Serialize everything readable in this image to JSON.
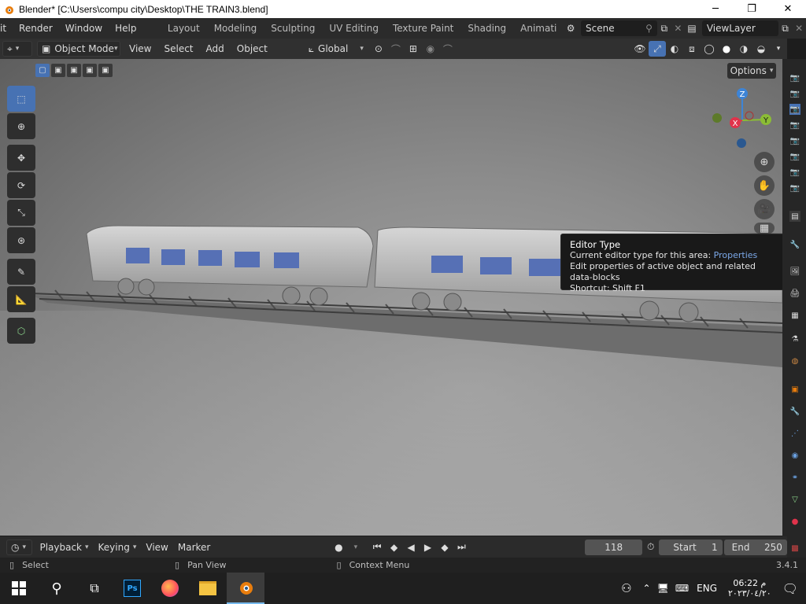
{
  "window": {
    "title": "Blender* [C:\\Users\\compu city\\Desktop\\THE TRAIN3.blend]",
    "minimize": "─",
    "maximize": "❐",
    "close": "✕"
  },
  "topbar": {
    "menus": [
      "it",
      "Render",
      "Window",
      "Help"
    ],
    "workspaces": [
      "Layout",
      "Modeling",
      "Sculpting",
      "UV Editing",
      "Texture Paint",
      "Shading",
      "Animati"
    ],
    "scene": "Scene",
    "view_layer": "ViewLayer"
  },
  "header": {
    "mode": "Object Mode",
    "menus": [
      "View",
      "Select",
      "Add",
      "Object"
    ],
    "orientation": "Global"
  },
  "viewport": {
    "options_label": "Options",
    "gizmo": {
      "z": "Z",
      "x": "X",
      "y": "Y"
    }
  },
  "tooltip": {
    "title": "Editor Type",
    "line1_prefix": "Current editor type for this area: ",
    "line1_value": "Properties",
    "line2": "Edit properties of active object and related data-blocks",
    "shortcut": "Shortcut: Shift F1"
  },
  "timeline": {
    "menus": [
      "Playback",
      "Keying",
      "View",
      "Marker"
    ],
    "current_frame": "118",
    "start_label": "Start",
    "start_value": "1",
    "end_label": "End",
    "end_value": "250"
  },
  "status": {
    "select": "Select",
    "pan": "Pan View",
    "context": "Context Menu",
    "version": "3.4.1"
  },
  "taskbar": {
    "lang": "ENG",
    "time": "06:22 م",
    "date": "٢٠٢٣/٠٤/٢٠"
  },
  "colors": {
    "accent": "#4772b3",
    "gizmo_x": "#e0334b",
    "gizmo_y": "#8bbd35",
    "gizmo_z": "#3d84d6"
  }
}
